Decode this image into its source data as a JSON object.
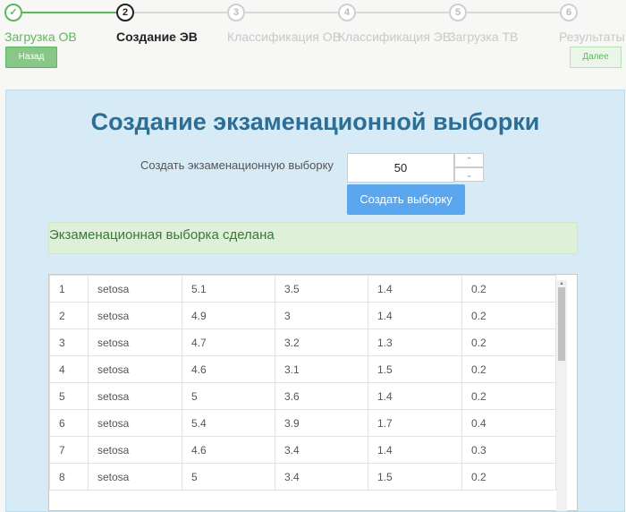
{
  "stepper": {
    "steps": [
      {
        "num": "✓",
        "label": "Загрузка ОВ"
      },
      {
        "num": "2",
        "label": "Создание ЭВ"
      },
      {
        "num": "3",
        "label": "Классификация ОВ"
      },
      {
        "num": "4",
        "label": "Классификация ЭВ"
      },
      {
        "num": "5",
        "label": "Загрузка ТВ"
      },
      {
        "num": "6",
        "label": "Результаты"
      }
    ],
    "back_label": "Назад",
    "next_label": "Далее"
  },
  "main": {
    "title": "Создание экзаменационной выборки",
    "size_label": "Создать экзаменационную выборку",
    "size_value": "50",
    "create_button": "Создать выборку",
    "success_message": "Экзаменационная выборка сделана"
  },
  "table": {
    "rows": [
      [
        "1",
        "setosa",
        "5.1",
        "3.5",
        "1.4",
        "0.2"
      ],
      [
        "2",
        "setosa",
        "4.9",
        "3",
        "1.4",
        "0.2"
      ],
      [
        "3",
        "setosa",
        "4.7",
        "3.2",
        "1.3",
        "0.2"
      ],
      [
        "4",
        "setosa",
        "4.6",
        "3.1",
        "1.5",
        "0.2"
      ],
      [
        "5",
        "setosa",
        "5",
        "3.6",
        "1.4",
        "0.2"
      ],
      [
        "6",
        "setosa",
        "5.4",
        "3.9",
        "1.7",
        "0.4"
      ],
      [
        "7",
        "setosa",
        "4.6",
        "3.4",
        "1.4",
        "0.3"
      ],
      [
        "8",
        "setosa",
        "5",
        "3.4",
        "1.5",
        "0.2"
      ]
    ]
  },
  "colors": {
    "success_green": "#5cb85c",
    "panel_background": "#d7ebf7",
    "title_blue": "#2c6e95",
    "button_blue": "#5aa7ef"
  }
}
